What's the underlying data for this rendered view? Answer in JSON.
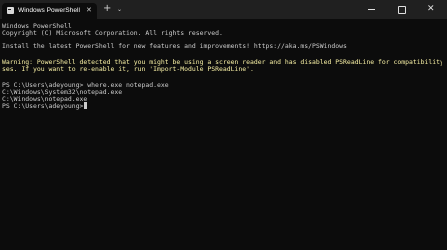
{
  "tab": {
    "icon": "powershell-icon",
    "title": "Windows PowerShell",
    "close_glyph": "✕"
  },
  "tabbar": {
    "new_tab_glyph": "+",
    "dropdown_glyph": "⌄"
  },
  "window_controls": {
    "close_glyph": "✕"
  },
  "console": {
    "lines": [
      "Windows PowerShell",
      "Copyright (C) Microsoft Corporation. All rights reserved.",
      "",
      "Install the latest PowerShell for new features and improvements! https://aka.ms/PSWindows",
      "",
      "Warning: PowerShell detected that you might be using a screen reader and has disabled PSReadLine for compatibility purpo",
      "ses. If you want to re-enable it, run 'Import-Module PSReadLine'.",
      "",
      "PS C:\\Users\\adeyoung> where.exe notepad.exe",
      "C:\\Windows\\System32\\notepad.exe",
      "C:\\Windows\\notepad.exe",
      "PS C:\\Users\\adeyoung>"
    ]
  },
  "colors": {
    "background": "#0c0c0c",
    "titlebar": "#202020",
    "text": "#cccccc",
    "warning_text": "#f9f1a5"
  }
}
